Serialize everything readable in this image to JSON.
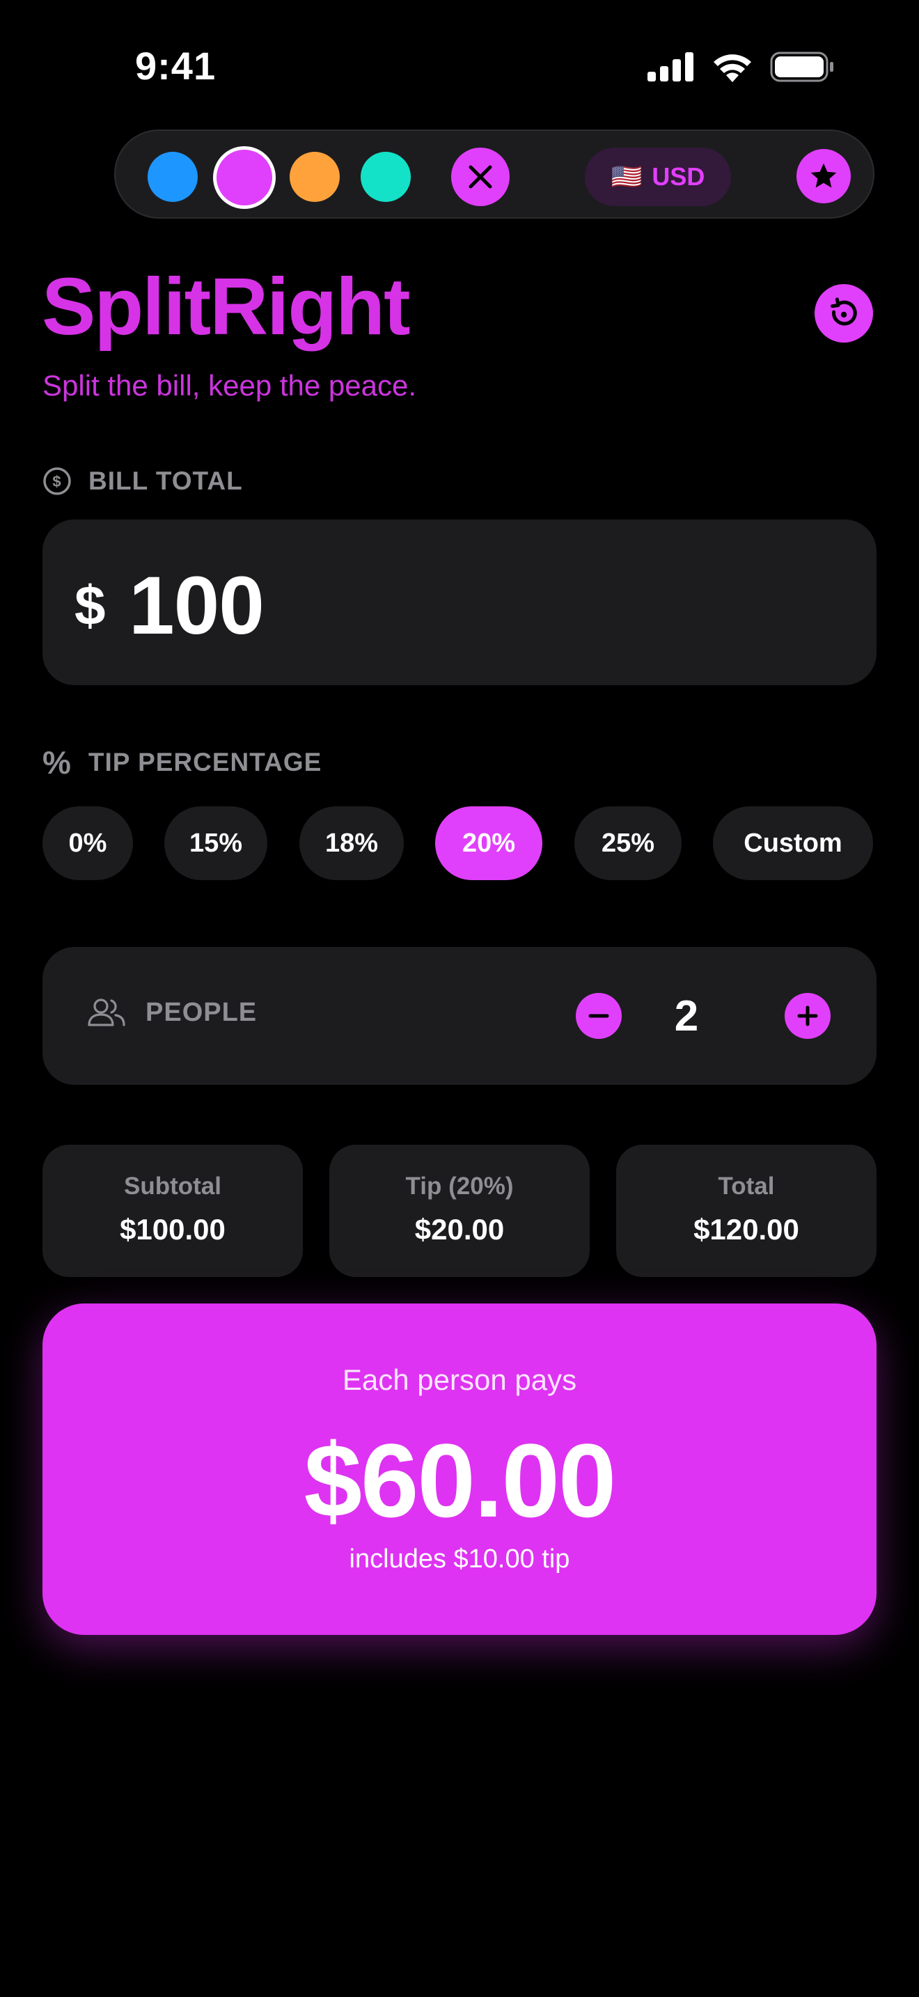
{
  "status_bar": {
    "time": "9:41"
  },
  "toolbar": {
    "swatches": [
      {
        "name": "blue",
        "color": "#1e96ff"
      },
      {
        "name": "magenta",
        "color": "#e040fb",
        "selected": true
      },
      {
        "name": "orange",
        "color": "#ffa23c"
      },
      {
        "name": "teal",
        "color": "#13e2c8"
      }
    ],
    "close_icon": "close-icon",
    "currency": {
      "flag": "🇺🇸",
      "code": "USD"
    },
    "star_icon": "star-icon"
  },
  "header": {
    "title": "SplitRight",
    "subtitle": "Split the bill, keep the peace.",
    "reset_icon": "reset-icon"
  },
  "bill": {
    "label": "BILL TOTAL",
    "currency_symbol": "$",
    "value": "100"
  },
  "tip": {
    "label": "TIP PERCENTAGE",
    "icon_glyph": "%",
    "options": [
      "0%",
      "15%",
      "18%",
      "20%",
      "25%",
      "Custom"
    ],
    "selected": "20%"
  },
  "people": {
    "label": "PEOPLE",
    "count": "2",
    "decrement_icon": "minus-icon",
    "increment_icon": "plus-icon"
  },
  "summary": {
    "subtotal_label": "Subtotal",
    "subtotal_value": "$100.00",
    "tip_label": "Tip (20%)",
    "tip_value": "$20.00",
    "total_label": "Total",
    "total_value": "$120.00"
  },
  "result": {
    "label": "Each person pays",
    "amount": "$60.00",
    "note": "includes $10.00 tip"
  },
  "colors": {
    "accent": "#e040fb",
    "background": "#000000",
    "card": "#1c1c1e",
    "muted_text": "#8e8e93"
  }
}
